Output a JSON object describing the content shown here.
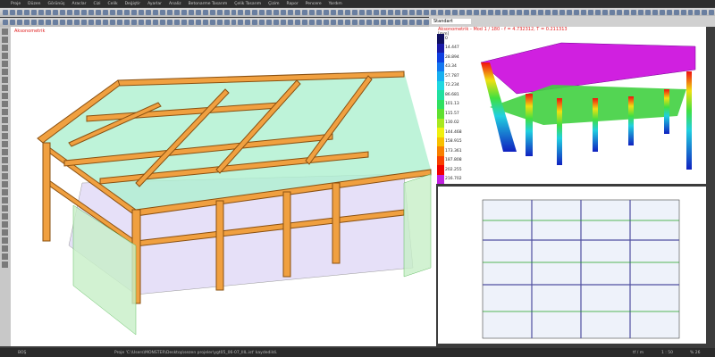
{
  "menu": [
    "Proje",
    "Düzen",
    "Görünüş",
    "Araclar",
    "Cizi",
    "Celik",
    "Değiştir",
    "Ayarlar",
    "Analiz",
    "Betonarme Tasarım",
    "Çelik Tasarım",
    "Çizim",
    "Rapor",
    "Pencere",
    "Yardım"
  ],
  "left_view": {
    "title": "Aksonometrik"
  },
  "right_tabs": {
    "style": "Standart"
  },
  "right_top": {
    "title": "Aksonometrik - Mod 1 / 180  -  f = 4.732312,  T = 0.211313",
    "unit": "[mm]",
    "legend": [
      {
        "v": "0",
        "c": "#101060"
      },
      {
        "v": "14.447",
        "c": "#1a1aa8"
      },
      {
        "v": "28.894",
        "c": "#1040e0"
      },
      {
        "v": "43.34",
        "c": "#1478f0"
      },
      {
        "v": "57.787",
        "c": "#18b0f0"
      },
      {
        "v": "72.234",
        "c": "#20d8e0"
      },
      {
        "v": "86.681",
        "c": "#20e0a0"
      },
      {
        "v": "101.13",
        "c": "#30e060"
      },
      {
        "v": "115.57",
        "c": "#60e030"
      },
      {
        "v": "130.02",
        "c": "#a8e820"
      },
      {
        "v": "144.468",
        "c": "#f0f010"
      },
      {
        "v": "158.915",
        "c": "#f8c000"
      },
      {
        "v": "173.361",
        "c": "#f88000"
      },
      {
        "v": "187.808",
        "c": "#f84000"
      },
      {
        "v": "202.255",
        "c": "#f00000"
      },
      {
        "v": "216.702",
        "c": "#c020e0"
      }
    ]
  },
  "status": {
    "mode": "BOŞ",
    "message": "Proje 'C:\\Users\\MONSTER\\Desktop\\sezen projeler\\ygt05_06-07_IIIL.ist' kaydedildi.",
    "units": "tf / m",
    "scale": "1 : 50",
    "zoom": "% 26"
  }
}
